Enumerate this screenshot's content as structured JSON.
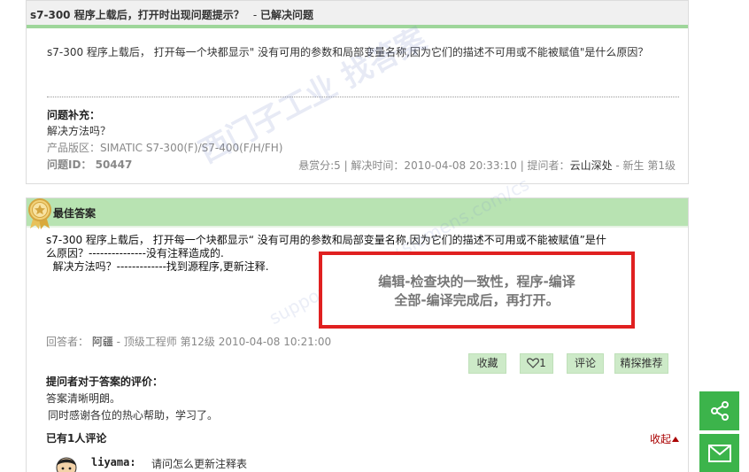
{
  "question": {
    "title": "s7-300 程序上载后，打开时出现问题提示？",
    "status_prefix": "- ",
    "status": "已解决问题",
    "body": "s7-300 程序上载后， 打开每一个块都显示\" 没有可用的参数和局部变量名称,因为它们的描述不可用或不能被赋值\"是什么原因？",
    "supplement_title": "问题补充：",
    "supplement_body": "解决方法吗？",
    "product": "产品版区：SIMATIC S7-300(F)/S7-400(F/H/FH)",
    "question_id": "问题ID： 50447",
    "meta": "悬赏分:5 | 解决时间：2010-04-08 20:33:10 | 提问者：",
    "asker": "云山深处",
    "asker_level": " - 新生  第1级"
  },
  "answer": {
    "header": "最佳答案",
    "lines": [
      "s7-300 程序上载后， 打开每一个块都显示“ 没有可用的参数和局部变量名称,因为它们的描述不可用或不能被赋值”是什",
      "么原因？---------------没有注释造成的.",
      "  解决方法吗？-------------找到源程序,更新注释."
    ],
    "callout": [
      "编辑-检查块的一致性，程序-编译",
      "全部-编译完成后，再打开。"
    ],
    "answerer_label": "回答者： ",
    "answerer": "阿疆",
    "answerer_meta": " - 顶级工程师  第12级  2010-04-08 10:21:00",
    "buttons": {
      "favorite": "收藏",
      "like_count": "1",
      "comment": "评论",
      "recommend": "精探推荐"
    },
    "evaluation_title": "提问者对于答案的评价：",
    "evaluation_line1": "答案清晰明朗。",
    "evaluation_line2": "同时感谢各位的热心帮助，学习了。",
    "comments_count": "已有1人评论",
    "collapse": "收起",
    "comment": {
      "user": "liyama:",
      "text": "请问怎么更新注释表"
    }
  },
  "watermark": {
    "line1": "西门子工业   找答案",
    "line2": "support.industry.siemens.com/cs"
  },
  "colors": {
    "accent_green": "#9ed69a",
    "header_green": "#b8e3b2",
    "button_green": "#cdeac8",
    "side_green": "#3cb44b",
    "callout_red": "#e02020"
  }
}
